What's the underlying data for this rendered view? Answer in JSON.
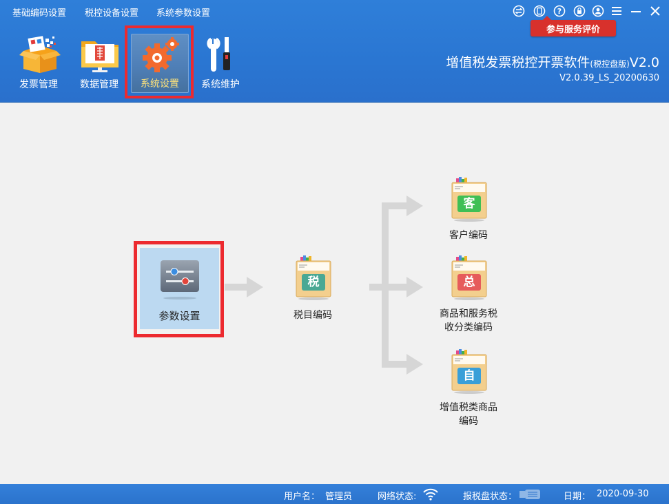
{
  "top_menu": [
    "基础编码设置",
    "税控设备设置",
    "系统参数设置"
  ],
  "window_controls": {
    "icons": [
      "switch-icon",
      "phone-icon",
      "help-icon",
      "lock-icon",
      "user-icon",
      "menu-icon",
      "minimize-icon",
      "close-icon"
    ]
  },
  "evaluation_badge": "参与服务评价",
  "toolbar": [
    {
      "label": "发票管理",
      "icon": "invoice-box-icon"
    },
    {
      "label": "数据管理",
      "icon": "data-folder-icon"
    },
    {
      "label": "系统设置",
      "icon": "gear-settings-icon",
      "active": true
    },
    {
      "label": "系统维护",
      "icon": "tools-icon"
    }
  ],
  "app": {
    "title": "增值税发票税控开票软件",
    "edition": "(税控盘版)",
    "version_suffix": "V2.0",
    "build": "V2.0.39_LS_20200630"
  },
  "flow": {
    "start": {
      "label": "参数设置",
      "icon": "slider-settings-icon"
    },
    "middle": {
      "label": "税目编码",
      "glyph": "税",
      "glyph_color": "#4aa894"
    },
    "targets": [
      {
        "label_lines": [
          "客户编码"
        ],
        "glyph": "客",
        "glyph_color": "#3fbf55"
      },
      {
        "label_lines": [
          "商品和服务税",
          "收分类编码"
        ],
        "glyph": "总",
        "glyph_color": "#e65b5b"
      },
      {
        "label_lines": [
          "增值税类商品",
          "编码"
        ],
        "glyph": "自",
        "glyph_color": "#3a9fd8"
      }
    ]
  },
  "status_bar": {
    "username_label": "用户名：",
    "username": "管理员",
    "network_label": "网络状态:",
    "disk_label": "报税盘状态：",
    "date_label": "日期：",
    "date": "2020-09-30"
  },
  "colors": {
    "header_blue": "#2a76d2",
    "highlight_red": "#ec2a2f",
    "active_label": "#ffe37a",
    "arrow_gray": "#d6d6d6"
  }
}
